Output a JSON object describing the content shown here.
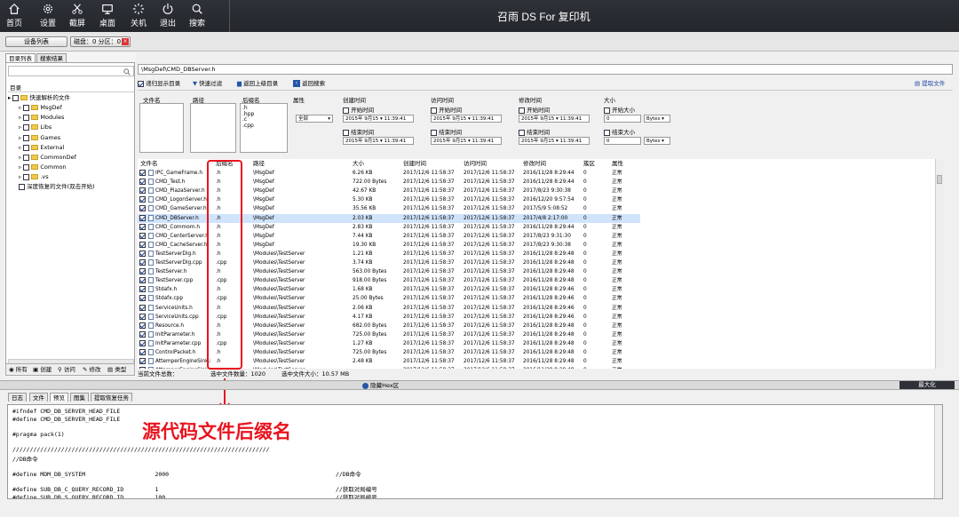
{
  "toolbar": {
    "items": [
      {
        "label": "首页",
        "icon": "home-icon"
      },
      {
        "label": "设置",
        "icon": "gear-icon"
      },
      {
        "label": "截屏",
        "icon": "scissors-icon"
      },
      {
        "label": "桌面",
        "icon": "monitor-icon"
      },
      {
        "label": "关机",
        "icon": "spinner-icon"
      },
      {
        "label": "退出",
        "icon": "power-icon"
      },
      {
        "label": "搜索",
        "icon": "search-icon"
      }
    ],
    "app_title": "召雨 DS  For 复印机"
  },
  "device_bar": {
    "device_list": "设备列表",
    "disk": "磁盘：0 分区：0"
  },
  "left_panel": {
    "tabs": [
      "目录列表",
      "搜索结果"
    ],
    "header": "目录",
    "root": "快速解析的文件",
    "folders": [
      "MsgDef",
      "Modules",
      "Libs",
      "Games",
      "External",
      "CommonDef",
      "Common",
      ".vs"
    ],
    "deep_restore": "深度恢复的文件(双击开始)",
    "filters": [
      "所有",
      "创建",
      "访问",
      "修改",
      "类型"
    ]
  },
  "path_bar": {
    "path": "\\MsgDef\\CMD_DBServer.h"
  },
  "action_bar": {
    "recursive": "递归显示目录",
    "quick_filter": "快速过滤",
    "go_up": "返回上级目录",
    "back_search": "返回搜索",
    "extract": "提取文件"
  },
  "filter": {
    "filename": "文件名",
    "path": "路径",
    "suffix": "后缀名",
    "attr": "属性",
    "suffix_values": [
      ".h",
      ".hpp",
      ".c",
      ".cpp"
    ],
    "attr_value": "全部",
    "created": "创建时间",
    "accessed": "访问时间",
    "modified": "修改时间",
    "size": "大小",
    "start_time": "开始时间",
    "end_time": "结束时间",
    "start_size": "开始大小",
    "end_size": "结束大小",
    "date": "2015年 9月15",
    "time": "11:39:41",
    "size_value": "0",
    "bytes": "Bytes"
  },
  "table": {
    "headers": [
      "文件名",
      "后缀名",
      "路径",
      "大小",
      "创建时间",
      "访问时间",
      "修改时间",
      "簇区",
      "属性"
    ],
    "rows": [
      [
        "IPC_GameFrame.h",
        ".h",
        "\\MsgDef",
        "6.26 KB",
        "2017/12/6 11:58:37",
        "2017/12/6 11:58:37",
        "2016/11/28 8:29:44",
        "0",
        "正常"
      ],
      [
        "CMD_Test.h",
        ".h",
        "\\MsgDef",
        "722.00 Bytes",
        "2017/12/6 11:58:37",
        "2017/12/6 11:58:37",
        "2016/11/28 8:29:44",
        "0",
        "正常"
      ],
      [
        "CMD_PlazaServer.h",
        ".h",
        "\\MsgDef",
        "42.67 KB",
        "2017/12/6 11:58:37",
        "2017/12/6 11:58:37",
        "2017/8/23 9:30:38",
        "0",
        "正常"
      ],
      [
        "CMD_LogonServer.h",
        ".h",
        "\\MsgDef",
        "5.30 KB",
        "2017/12/6 11:58:37",
        "2017/12/6 11:58:37",
        "2016/12/20 9:57:54",
        "0",
        "正常"
      ],
      [
        "CMD_GameServer.h",
        ".h",
        "\\MsgDef",
        "35.56 KB",
        "2017/12/6 11:58:37",
        "2017/12/6 11:58:37",
        "2017/5/9 5:08:52",
        "0",
        "正常"
      ],
      [
        "CMD_DBServer.h",
        ".h",
        "\\MsgDef",
        "2.03 KB",
        "2017/12/6 11:58:37",
        "2017/12/6 11:58:37",
        "2017/4/8 2:17:00",
        "0",
        "正常"
      ],
      [
        "CMD_Commom.h",
        ".h",
        "\\MsgDef",
        "2.83 KB",
        "2017/12/6 11:58:37",
        "2017/12/6 11:58:37",
        "2016/11/28 8:29:44",
        "0",
        "正常"
      ],
      [
        "CMD_CenterServer.h",
        ".h",
        "\\MsgDef",
        "7.44 KB",
        "2017/12/6 11:58:37",
        "2017/12/6 11:58:37",
        "2017/8/23 9:31:30",
        "0",
        "正常"
      ],
      [
        "CMD_CacheServer.h",
        ".h",
        "\\MsgDef",
        "19.30 KB",
        "2017/12/6 11:58:37",
        "2017/12/6 11:58:37",
        "2017/8/23 9:30:38",
        "0",
        "正常"
      ],
      [
        "TestServerDlg.h",
        ".h",
        "\\Modules\\TestServer",
        "1.21 KB",
        "2017/12/6 11:58:37",
        "2017/12/6 11:58:37",
        "2016/11/28 8:29:48",
        "0",
        "正常"
      ],
      [
        "TestServerDlg.cpp",
        ".cpp",
        "\\Modules\\TestServer",
        "3.74 KB",
        "2017/12/6 11:58:37",
        "2017/12/6 11:58:37",
        "2016/11/28 8:29:48",
        "0",
        "正常"
      ],
      [
        "TestServer.h",
        ".h",
        "\\Modules\\TestServer",
        "563.00 Bytes",
        "2017/12/6 11:58:37",
        "2017/12/6 11:58:37",
        "2016/11/28 8:29:48",
        "0",
        "正常"
      ],
      [
        "TestServer.cpp",
        ".cpp",
        "\\Modules\\TestServer",
        "918.00 Bytes",
        "2017/12/6 11:58:37",
        "2017/12/6 11:58:37",
        "2016/11/28 8:29:48",
        "0",
        "正常"
      ],
      [
        "Stdafx.h",
        ".h",
        "\\Modules\\TestServer",
        "1.68 KB",
        "2017/12/6 11:58:37",
        "2017/12/6 11:58:37",
        "2016/11/28 8:29:46",
        "0",
        "正常"
      ],
      [
        "Stdafx.cpp",
        ".cpp",
        "\\Modules\\TestServer",
        "25.00 Bytes",
        "2017/12/6 11:58:37",
        "2017/12/6 11:58:37",
        "2016/11/28 8:29:46",
        "0",
        "正常"
      ],
      [
        "ServiceUnits.h",
        ".h",
        "\\Modules\\TestServer",
        "2.06 KB",
        "2017/12/6 11:58:37",
        "2017/12/6 11:58:37",
        "2016/11/28 8:29:46",
        "0",
        "正常"
      ],
      [
        "ServiceUnits.cpp",
        ".cpp",
        "\\Modules\\TestServer",
        "4.17 KB",
        "2017/12/6 11:58:37",
        "2017/12/6 11:58:37",
        "2016/11/28 8:29:46",
        "0",
        "正常"
      ],
      [
        "Resource.h",
        ".h",
        "\\Modules\\TestServer",
        "682.00 Bytes",
        "2017/12/6 11:58:37",
        "2017/12/6 11:58:37",
        "2016/11/28 8:29:48",
        "0",
        "正常"
      ],
      [
        "InitParameter.h",
        ".h",
        "\\Modules\\TestServer",
        "725.00 Bytes",
        "2017/12/6 11:58:37",
        "2017/12/6 11:58:37",
        "2016/11/28 8:29:48",
        "0",
        "正常"
      ],
      [
        "InitParameter.cpp",
        ".cpp",
        "\\Modules\\TestServer",
        "1.27 KB",
        "2017/12/6 11:58:37",
        "2017/12/6 11:58:37",
        "2016/11/28 8:29:48",
        "0",
        "正常"
      ],
      [
        "ControlPacket.h",
        ".h",
        "\\Modules\\TestServer",
        "725.00 Bytes",
        "2017/12/6 11:58:37",
        "2017/12/6 11:58:37",
        "2016/11/28 8:29:48",
        "0",
        "正常"
      ],
      [
        "AttemperEngineSink.h",
        ".h",
        "\\Modules\\TestServer",
        "2.48 KB",
        "2017/12/6 11:58:37",
        "2017/12/6 11:58:37",
        "2016/11/28 8:29:48",
        "0",
        "正常"
      ],
      [
        "AttemperEngineSink.cpp",
        ".cpp",
        "\\Modules\\TestServer",
        "",
        "2017/12/6 11:58:37",
        "2017/12/6 11:58:37",
        "2016/11/28 8:29:48",
        "0",
        "正常"
      ]
    ]
  },
  "status": {
    "total": "当前文件总数：",
    "selected": "选中文件数量：1020",
    "selected_size": "选中文件大小：10.57 MB"
  },
  "hex_bar": {
    "hide_hex": "隐藏Hex区",
    "maximize": "最大化"
  },
  "bottom_tabs": [
    "日志",
    "文件",
    "预览",
    "图集",
    "提取恢复任务"
  ],
  "annotation": "源代码文件后缀名",
  "code_lines": [
    "#ifndef CMD_DB_SERVER_HEAD_FILE",
    "#define CMD_DB_SERVER_HEAD_FILE",
    "",
    "#pragma pack(1)",
    "",
    "//////////////////////////////////////////////////////////////////////////",
    "//DB命令",
    "",
    "#define MDM_DB_SYSTEM                    2000                                                //DB命令",
    "",
    "#define SUB_DB_C_QUERY_RECORD_ID         1                                                   //获取对局编号",
    "#define SUB_DB_S_QUERY_RECORD_ID         100                                                 //获取对局编号"
  ],
  "colors": {
    "topbar": "#2a2d33",
    "highlight": "#cfe3fb",
    "annotation": "#e8141e"
  }
}
